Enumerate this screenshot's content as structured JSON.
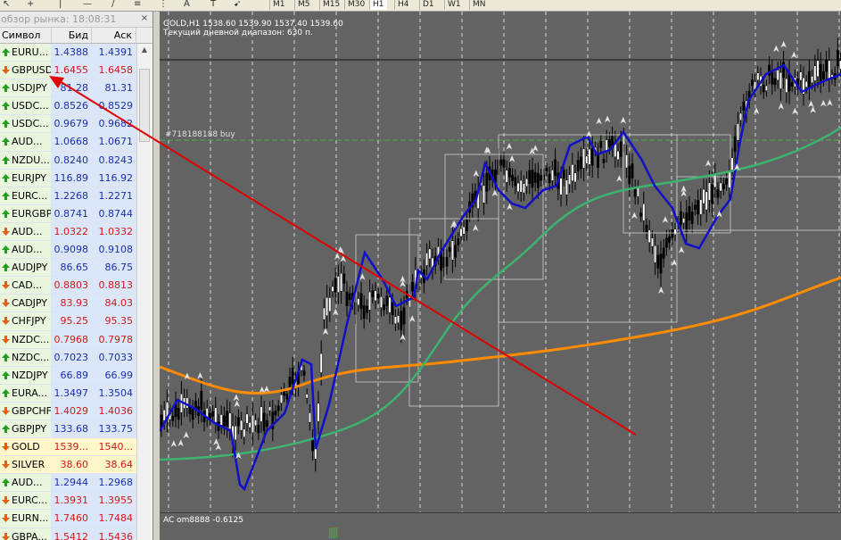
{
  "toolbar": {
    "timeframes": [
      "M1",
      "M5",
      "M15",
      "M30",
      "H1",
      "H4",
      "D1",
      "W1",
      "MN"
    ],
    "active_timeframe": "H1"
  },
  "market_watch": {
    "title": "обзор рынка: 18:08:31",
    "columns": {
      "symbol": "Символ",
      "bid": "Бид",
      "ask": "Аск"
    },
    "rows": [
      {
        "symbol": "EURU...",
        "bid": "1.4388",
        "ask": "1.4391",
        "dir": "up"
      },
      {
        "symbol": "GBPUSD",
        "bid": "1.6455",
        "ask": "1.6458",
        "dir": "down"
      },
      {
        "symbol": "USDJPY",
        "bid": "81.28",
        "ask": "81.31",
        "dir": "up"
      },
      {
        "symbol": "USDC...",
        "bid": "0.8526",
        "ask": "0.8529",
        "dir": "up"
      },
      {
        "symbol": "USDC...",
        "bid": "0.9679",
        "ask": "0.9682",
        "dir": "up"
      },
      {
        "symbol": "AUD...",
        "bid": "1.0668",
        "ask": "1.0671",
        "dir": "up"
      },
      {
        "symbol": "NZDU...",
        "bid": "0.8240",
        "ask": "0.8243",
        "dir": "up"
      },
      {
        "symbol": "EURJPY",
        "bid": "116.89",
        "ask": "116.92",
        "dir": "up"
      },
      {
        "symbol": "EURC...",
        "bid": "1.2268",
        "ask": "1.2271",
        "dir": "up"
      },
      {
        "symbol": "EURGBP",
        "bid": "0.8741",
        "ask": "0.8744",
        "dir": "up"
      },
      {
        "symbol": "AUD...",
        "bid": "1.0322",
        "ask": "1.0332",
        "dir": "down"
      },
      {
        "symbol": "AUD...",
        "bid": "0.9098",
        "ask": "0.9108",
        "dir": "up"
      },
      {
        "symbol": "AUDJPY",
        "bid": "86.65",
        "ask": "86.75",
        "dir": "up"
      },
      {
        "symbol": "CAD...",
        "bid": "0.8803",
        "ask": "0.8813",
        "dir": "down"
      },
      {
        "symbol": "CADJPY",
        "bid": "83.93",
        "ask": "84.03",
        "dir": "down"
      },
      {
        "symbol": "CHFJPY",
        "bid": "95.25",
        "ask": "95.35",
        "dir": "down"
      },
      {
        "symbol": "NZDC...",
        "bid": "0.7968",
        "ask": "0.7978",
        "dir": "down"
      },
      {
        "symbol": "NZDC...",
        "bid": "0.7023",
        "ask": "0.7033",
        "dir": "up"
      },
      {
        "symbol": "NZDJPY",
        "bid": "66.89",
        "ask": "66.99",
        "dir": "up"
      },
      {
        "symbol": "EURA...",
        "bid": "1.3497",
        "ask": "1.3504",
        "dir": "up"
      },
      {
        "symbol": "GBPCHF",
        "bid": "1.4029",
        "ask": "1.4036",
        "dir": "down"
      },
      {
        "symbol": "GBPJPY",
        "bid": "133.68",
        "ask": "133.75",
        "dir": "up"
      },
      {
        "symbol": "GOLD",
        "bid": "1539...",
        "ask": "1540...",
        "dir": "down",
        "highlight": true
      },
      {
        "symbol": "SILVER",
        "bid": "38.60",
        "ask": "38.64",
        "dir": "down",
        "highlight": true
      },
      {
        "symbol": "AUD...",
        "bid": "1.2944",
        "ask": "1.2968",
        "dir": "up"
      },
      {
        "symbol": "EURC...",
        "bid": "1.3931",
        "ask": "1.3955",
        "dir": "down"
      },
      {
        "symbol": "EURN...",
        "bid": "1.7460",
        "ask": "1.7484",
        "dir": "down"
      },
      {
        "symbol": "GBPA...",
        "bid": "1.5412",
        "ask": "1.5436",
        "dir": "down"
      }
    ]
  },
  "chart": {
    "symbol_line": "GOLD,H1  1538.60 1539.90 1537.40 1539.60",
    "range_line": "Текущий дневной диапазон: 630 п.",
    "order_label": "#718188188 buy",
    "indicator_label": "AC om8888 -0.6125",
    "colors": {
      "background": "#636363",
      "grid": "#ffffff",
      "candles": "#000000",
      "ma_fast": "#1010c8",
      "ma_mid": "#3cb46e",
      "ma_slow": "#ff8c00",
      "trend_line": "#e00000",
      "order_line": "#4fae4f"
    }
  }
}
